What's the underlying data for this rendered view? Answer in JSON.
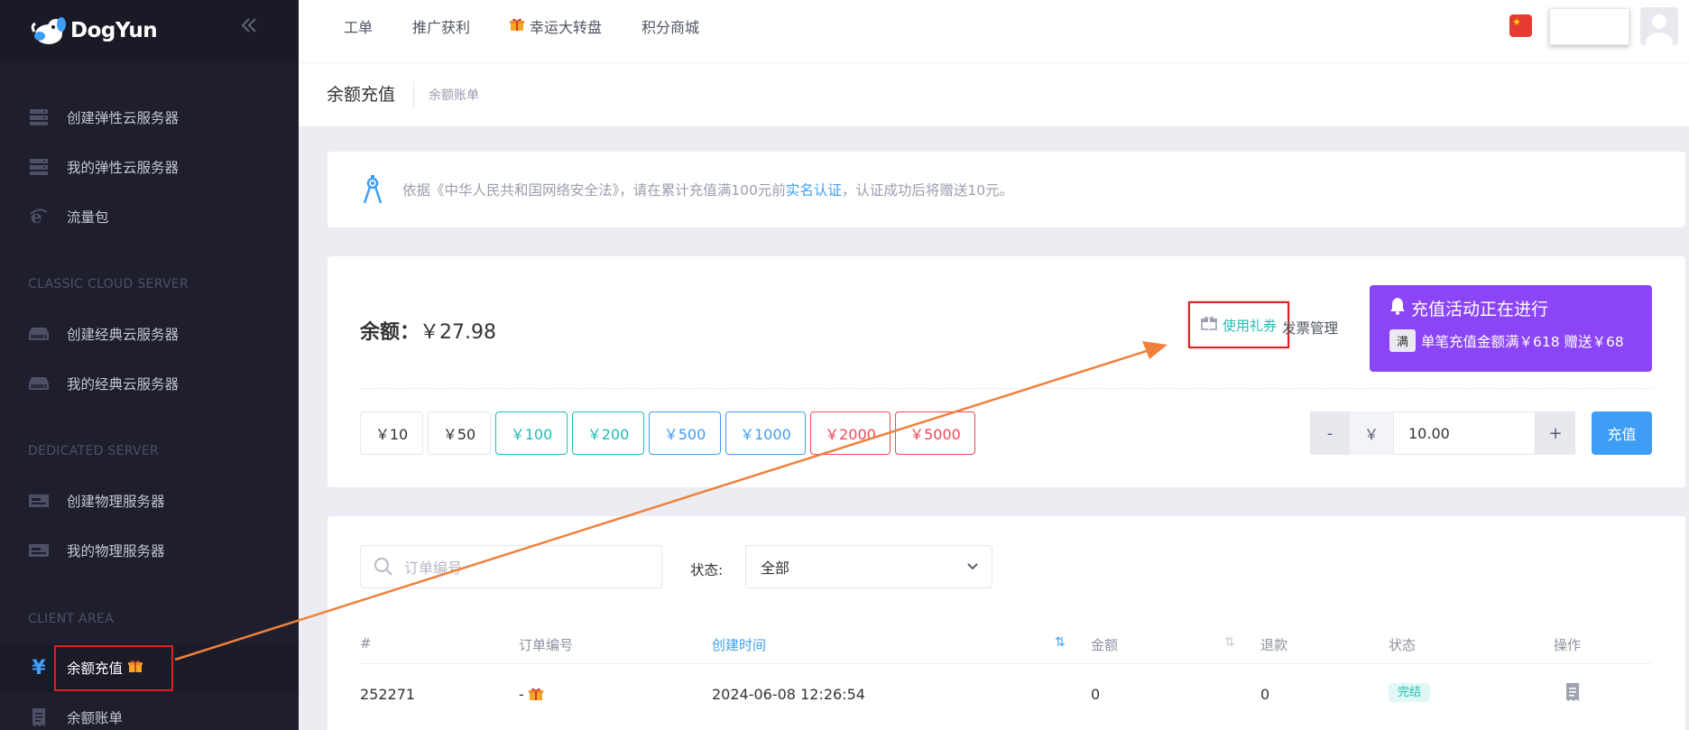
{
  "brand": {
    "name": "DogYun"
  },
  "sidebar": {
    "items_top": [
      {
        "label": "创建弹性云服务器",
        "icon": "server-stack-icon"
      },
      {
        "label": "我的弹性云服务器",
        "icon": "server-stack-icon"
      },
      {
        "label": "流量包",
        "icon": "traffic-icon"
      }
    ],
    "section_classic": "CLASSIC CLOUD SERVER",
    "items_classic": [
      {
        "label": "创建经典云服务器",
        "icon": "drive-icon"
      },
      {
        "label": "我的经典云服务器",
        "icon": "drive-icon"
      }
    ],
    "section_dedicated": "DEDICATED SERVER",
    "items_dedicated": [
      {
        "label": "创建物理服务器",
        "icon": "hardware-icon"
      },
      {
        "label": "我的物理服务器",
        "icon": "hardware-icon"
      }
    ],
    "section_client": "CLIENT AREA",
    "active_item": {
      "label": "余额充值",
      "icon_glyph": "¥"
    },
    "item_bill": {
      "label": "余额账单"
    }
  },
  "topnav": {
    "items": [
      "工单",
      "推广获利",
      "幸运大转盘",
      "积分商城"
    ],
    "lucky_icon": "gift-icon"
  },
  "subheader": {
    "title": "余额充值",
    "crumb": "余额账单"
  },
  "notice": {
    "before": "依据《中华人民共和国网络安全法》，请在累计充值满100元前",
    "link": "实名认证",
    "after": "，认证成功后将赠送10元。"
  },
  "balance": {
    "label": "余额：",
    "value": "￥27.98",
    "coupon": "使用礼券",
    "invoice": "发票管理",
    "promo_title": "充值活动正在进行",
    "promo_badge": "满",
    "promo_text": "单笔充值金额满￥618 赠送￥68",
    "amounts": [
      {
        "label": "￥10",
        "style": "default"
      },
      {
        "label": "￥50",
        "style": "default"
      },
      {
        "label": "￥100",
        "style": "teal"
      },
      {
        "label": "￥200",
        "style": "teal"
      },
      {
        "label": "￥500",
        "style": "blue"
      },
      {
        "label": "￥1000",
        "style": "blue"
      },
      {
        "label": "￥2000",
        "style": "red"
      },
      {
        "label": "￥5000",
        "style": "red"
      }
    ],
    "minus": "-",
    "currency": "￥",
    "input_value": "10.00",
    "plus": "+",
    "pay": "充值"
  },
  "orders": {
    "search_placeholder": "订单编号",
    "status_label": "状态:",
    "status_value": "全部",
    "columns": [
      "#",
      "订单编号",
      "创建时间",
      "金额",
      "退款",
      "状态",
      "操作"
    ],
    "rows": [
      {
        "id": "252271",
        "order_no": "-",
        "created": "2024-06-08 12:26:54",
        "amount": "0",
        "refund": "0",
        "status": "完结"
      }
    ]
  },
  "colors": {
    "sidebar_bg": "#1e1e2d",
    "accent_blue": "#3e9ef5",
    "teal": "#1cbfb3",
    "red": "#f5455a",
    "promo_purple": "#8b45f6",
    "annotation_red": "#e02020",
    "arrow_orange": "#f0803c"
  }
}
